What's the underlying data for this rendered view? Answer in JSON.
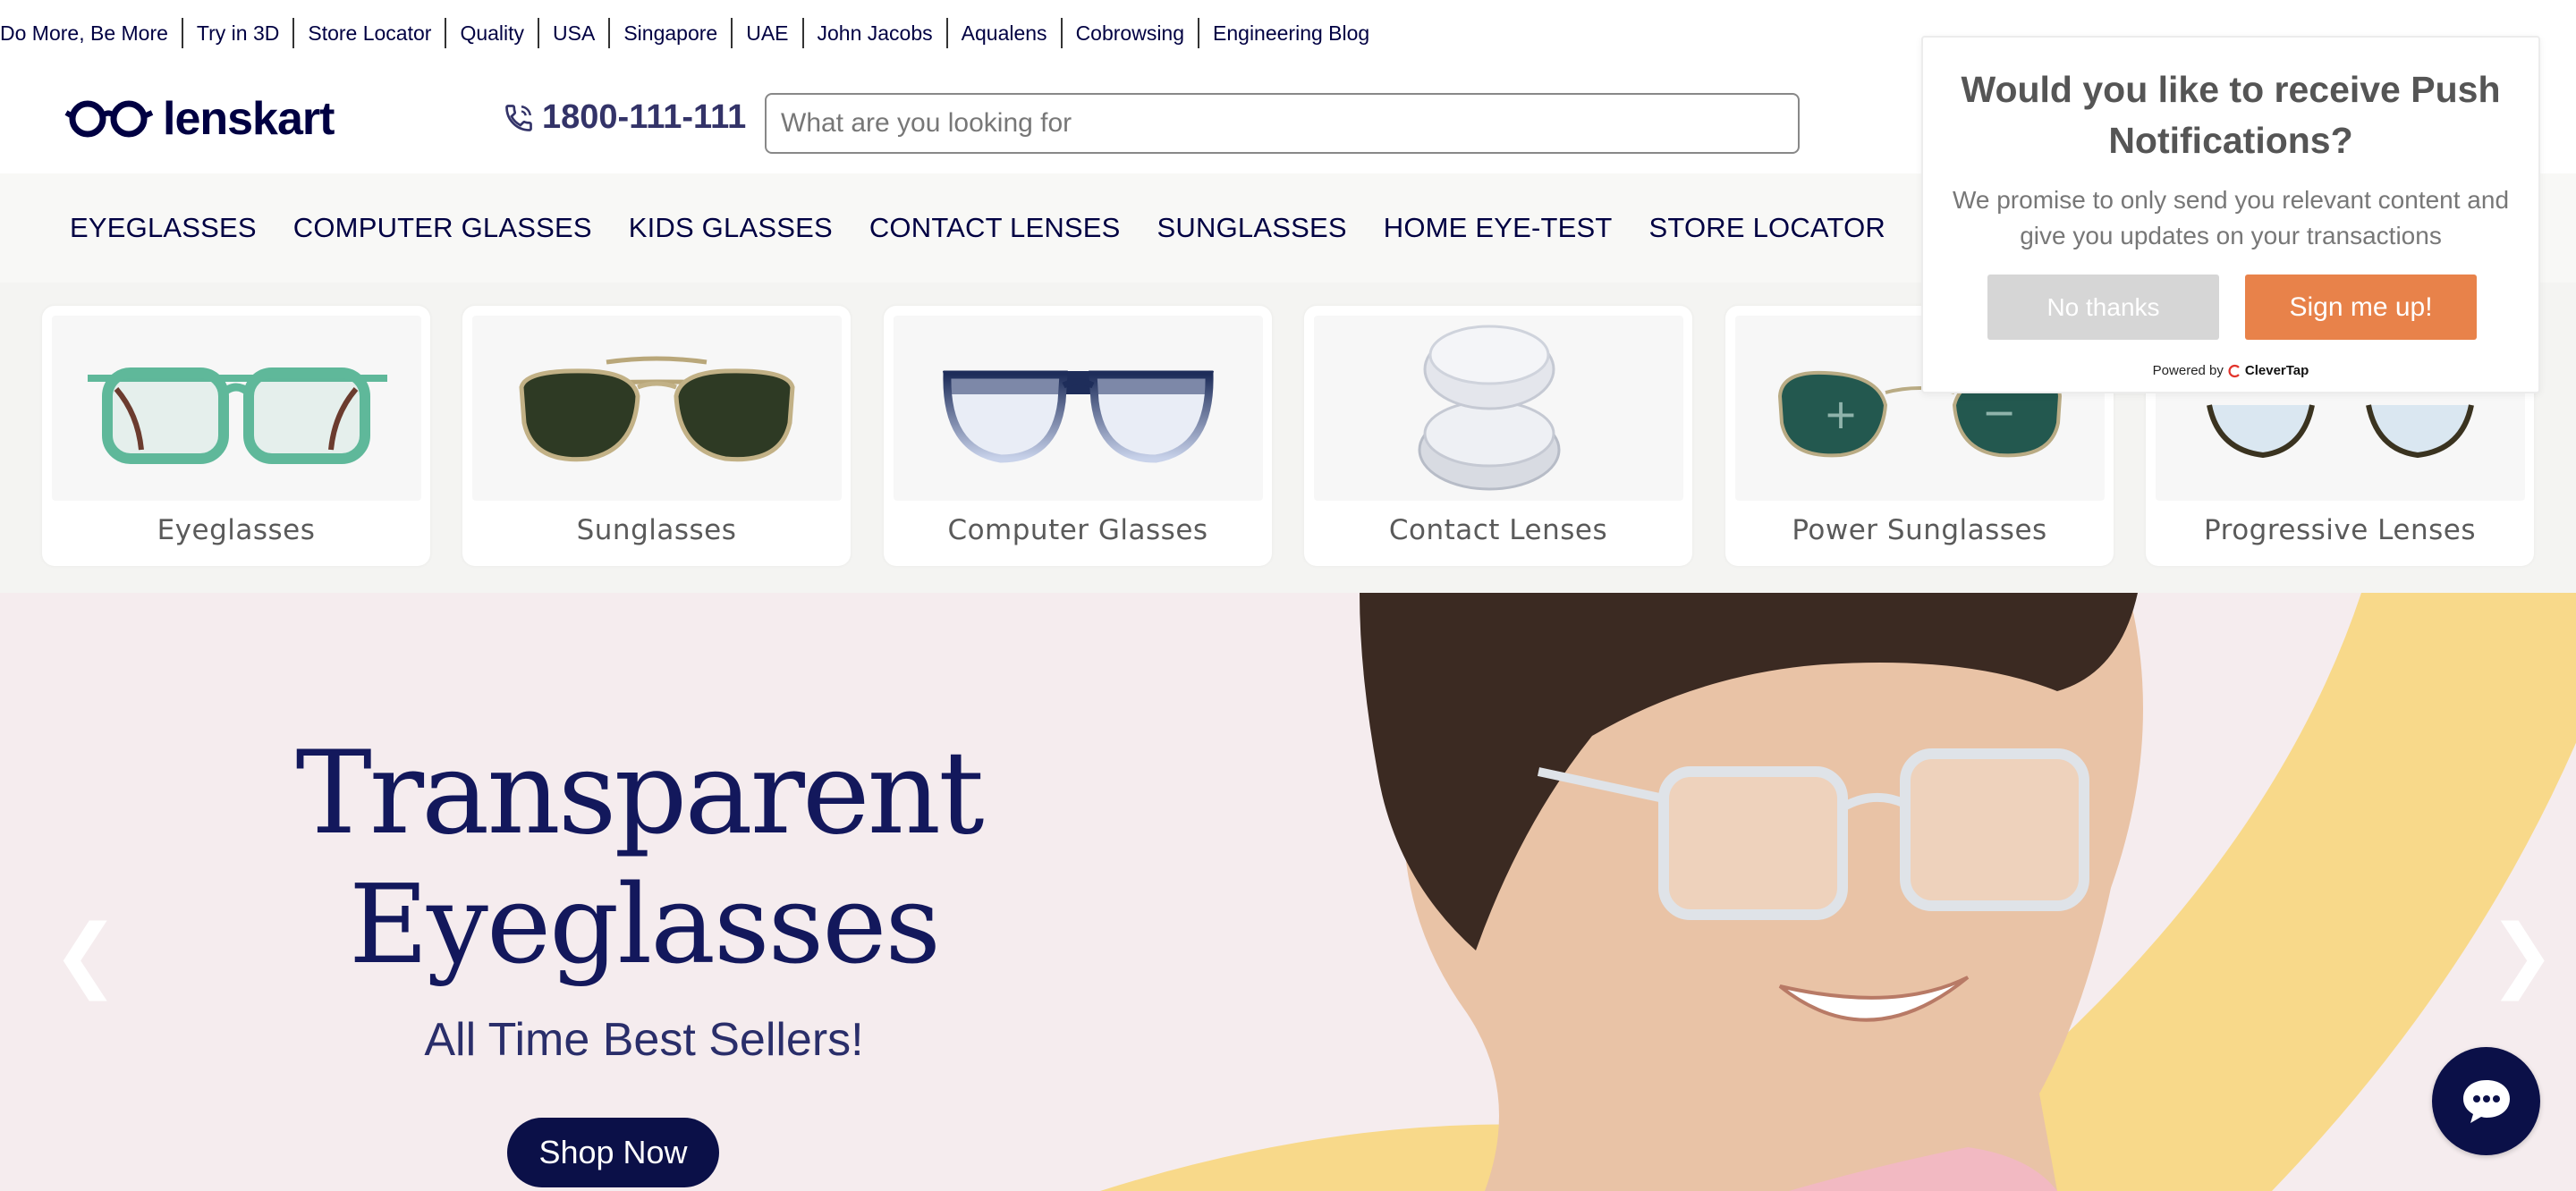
{
  "top_links": [
    "Do More, Be More",
    "Try in 3D",
    "Store Locator",
    "Quality",
    "USA",
    "Singapore",
    "UAE",
    "John Jacobs",
    "Aqualens",
    "Cobrowsing",
    "Engineering Blog"
  ],
  "header": {
    "logo_text": "lenskart",
    "phone": "1800-111-111",
    "search_placeholder": "What are you looking for"
  },
  "main_nav": [
    "EYEGLASSES",
    "COMPUTER GLASSES",
    "KIDS GLASSES",
    "CONTACT LENSES",
    "SUNGLASSES",
    "HOME EYE-TEST",
    "STORE LOCATOR"
  ],
  "categories": [
    "Eyeglasses",
    "Sunglasses",
    "Computer Glasses",
    "Contact Lenses",
    "Power Sunglasses",
    "Progressive Lenses"
  ],
  "hero": {
    "title_line1": "Transparent",
    "title_line2": "Eyeglasses",
    "subtitle": "All Time Best Sellers!",
    "cta": "Shop Now",
    "prev_arrow": "❮",
    "next_arrow": "❯"
  },
  "push_popup": {
    "title": "Would you like to receive Push Notifications?",
    "body": "We promise to only send you relevant content and give you updates on your transactions",
    "decline": "No thanks",
    "accept": "Sign me up!",
    "powered_by": "Powered by",
    "brand": "CleverTap"
  },
  "colors": {
    "brand_navy": "#000042",
    "accent_orange": "#e8824a",
    "hero_bg": "#f5ecee",
    "hero_arc": "#f8d98a"
  }
}
